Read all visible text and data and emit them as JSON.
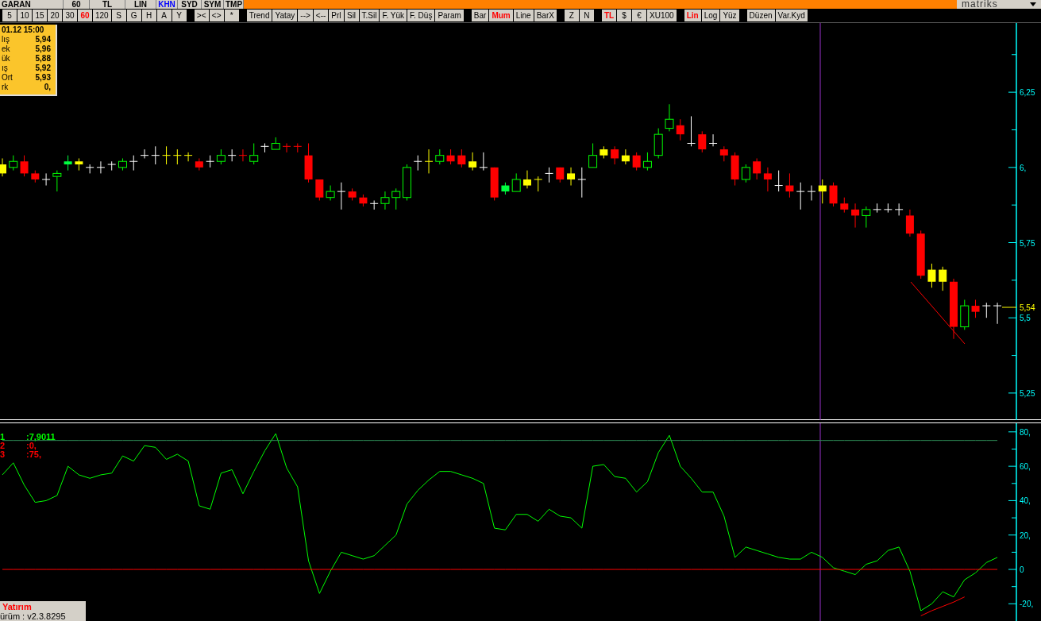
{
  "top_bar": {
    "items": [
      {
        "label": "GARAN",
        "highlighted": false
      },
      {
        "label": "60",
        "highlighted": false
      },
      {
        "label": "TL",
        "highlighted": false
      },
      {
        "label": "LIN",
        "highlighted": false
      },
      {
        "label": "KHN",
        "highlighted": true
      },
      {
        "label": "SYD",
        "highlighted": false
      },
      {
        "label": "SYM",
        "highlighted": false
      },
      {
        "label": "TMP",
        "highlighted": false
      }
    ],
    "logo": "matriks"
  },
  "toolbar": {
    "groups": [
      [
        {
          "label": "5",
          "selected": false
        },
        {
          "label": "10",
          "selected": false
        },
        {
          "label": "15",
          "selected": false
        },
        {
          "label": "20",
          "selected": false
        },
        {
          "label": "30",
          "selected": false
        },
        {
          "label": "60",
          "selected": true
        },
        {
          "label": "120",
          "selected": false
        },
        {
          "label": "S",
          "selected": false
        },
        {
          "label": "G",
          "selected": false
        },
        {
          "label": "H",
          "selected": false
        },
        {
          "label": "A",
          "selected": false
        },
        {
          "label": "Y",
          "selected": false
        }
      ],
      [
        {
          "label": "><",
          "selected": false
        },
        {
          "label": "<>",
          "selected": false
        },
        {
          "label": "*",
          "selected": false
        }
      ],
      [
        {
          "label": "Trend",
          "selected": false
        },
        {
          "label": "Yatay",
          "selected": false
        },
        {
          "label": "-->",
          "selected": false
        },
        {
          "label": "<--",
          "selected": false
        },
        {
          "label": "Prl",
          "selected": false
        },
        {
          "label": "Sil",
          "selected": false
        },
        {
          "label": "T.Sil",
          "selected": false
        },
        {
          "label": "F. Yük",
          "selected": false
        },
        {
          "label": "F. Düş",
          "selected": false
        },
        {
          "label": "Param",
          "selected": false
        }
      ],
      [
        {
          "label": "Bar",
          "selected": false
        },
        {
          "label": "Mum",
          "selected": true
        },
        {
          "label": "Line",
          "selected": false
        },
        {
          "label": "BarX",
          "selected": false
        }
      ],
      [
        {
          "label": "Z",
          "selected": false
        },
        {
          "label": "N",
          "selected": false
        }
      ],
      [
        {
          "label": "TL",
          "selected": true
        },
        {
          "label": "$",
          "selected": false
        },
        {
          "label": "€",
          "selected": false
        },
        {
          "label": "XU100",
          "selected": false
        }
      ],
      [
        {
          "label": "Lin",
          "selected": true
        },
        {
          "label": "Log",
          "selected": false
        },
        {
          "label": "Yüz",
          "selected": false
        }
      ],
      [
        {
          "label": "Düzen",
          "selected": false
        },
        {
          "label": "Var.Kyd",
          "selected": false
        }
      ]
    ]
  },
  "info_box": {
    "title": "01.12 15:00",
    "rows": [
      {
        "label": "lış",
        "value": "5,94"
      },
      {
        "label": "ek",
        "value": "5,96"
      },
      {
        "label": "ük",
        "value": "5,88"
      },
      {
        "label": "ış",
        "value": "5,92"
      },
      {
        "label": "Ort",
        "value": "5,93"
      },
      {
        "label": "rk",
        "value": "0,"
      }
    ]
  },
  "price_panel": {
    "current_price": "5,54",
    "chart_data": {
      "type": "candlestick",
      "ylim": [
        5.16,
        6.48
      ],
      "yticks": [
        {
          "value": 6.25,
          "label": "6,25"
        },
        {
          "value": 6,
          "label": "6,"
        },
        {
          "value": 5.75,
          "label": "5,75"
        },
        {
          "value": 5.5,
          "label": "5,5"
        },
        {
          "value": 5.25,
          "label": "5,25"
        }
      ],
      "ohlc": [
        [
          6.01,
          6.03,
          5.97,
          5.98
        ],
        [
          6.0,
          6.04,
          5.99,
          6.02
        ],
        [
          6.02,
          6.04,
          5.97,
          5.98
        ],
        [
          5.98,
          5.99,
          5.95,
          5.96
        ],
        [
          5.96,
          5.98,
          5.94,
          5.96
        ],
        [
          5.97,
          5.99,
          5.92,
          5.98
        ],
        [
          6.01,
          6.04,
          5.99,
          6.02
        ],
        [
          6.02,
          6.03,
          5.99,
          6.01
        ],
        [
          6.0,
          6.01,
          5.98,
          6.0
        ],
        [
          6.0,
          6.02,
          5.98,
          6.0
        ],
        [
          6.01,
          6.02,
          5.99,
          6.01
        ],
        [
          6.0,
          6.03,
          5.99,
          6.02
        ],
        [
          6.02,
          6.04,
          5.99,
          6.02
        ],
        [
          6.04,
          6.06,
          6.03,
          6.04
        ],
        [
          6.04,
          6.07,
          6.01,
          6.04
        ],
        [
          6.04,
          6.07,
          6.01,
          6.04
        ],
        [
          6.04,
          6.06,
          6.01,
          6.04
        ],
        [
          6.04,
          6.05,
          6.02,
          6.04
        ],
        [
          6.02,
          6.03,
          5.99,
          6.0
        ],
        [
          6.02,
          6.04,
          6.0,
          6.02
        ],
        [
          6.02,
          6.06,
          6.01,
          6.04
        ],
        [
          6.04,
          6.06,
          6.02,
          6.04
        ],
        [
          6.04,
          6.06,
          6.02,
          6.04
        ],
        [
          6.02,
          6.08,
          6.01,
          6.04
        ],
        [
          6.07,
          6.08,
          6.05,
          6.07
        ],
        [
          6.06,
          6.1,
          6.06,
          6.08
        ],
        [
          6.07,
          6.08,
          6.05,
          6.07
        ],
        [
          6.07,
          6.08,
          6.05,
          6.07
        ],
        [
          6.04,
          6.08,
          5.95,
          5.96
        ],
        [
          5.96,
          5.96,
          5.89,
          5.9
        ],
        [
          5.9,
          5.94,
          5.89,
          5.92
        ],
        [
          5.92,
          5.95,
          5.86,
          5.92
        ],
        [
          5.92,
          5.93,
          5.89,
          5.9
        ],
        [
          5.9,
          5.91,
          5.87,
          5.88
        ],
        [
          5.88,
          5.89,
          5.86,
          5.88
        ],
        [
          5.88,
          5.92,
          5.86,
          5.9
        ],
        [
          5.9,
          5.93,
          5.86,
          5.92
        ],
        [
          5.9,
          6.01,
          5.89,
          6.0
        ],
        [
          6.02,
          6.04,
          5.99,
          6.02
        ],
        [
          6.02,
          6.06,
          5.98,
          6.02
        ],
        [
          6.02,
          6.06,
          6.01,
          6.04
        ],
        [
          6.04,
          6.06,
          6.01,
          6.02
        ],
        [
          6.04,
          6.06,
          6.0,
          6.01
        ],
        [
          6.02,
          6.05,
          5.99,
          6.0
        ],
        [
          6.0,
          6.05,
          5.99,
          6.0
        ],
        [
          6.0,
          6.0,
          5.89,
          5.9
        ],
        [
          5.92,
          5.95,
          5.91,
          5.94
        ],
        [
          5.92,
          5.98,
          5.92,
          5.96
        ],
        [
          5.96,
          5.99,
          5.93,
          5.94
        ],
        [
          5.96,
          5.97,
          5.92,
          5.96
        ],
        [
          5.98,
          6.0,
          5.95,
          5.98
        ],
        [
          6.0,
          6.0,
          5.95,
          5.96
        ],
        [
          5.98,
          6.0,
          5.94,
          5.96
        ],
        [
          5.96,
          6.0,
          5.9,
          5.96
        ],
        [
          6.0,
          6.08,
          6.0,
          6.04
        ],
        [
          6.06,
          6.07,
          6.03,
          6.04
        ],
        [
          6.06,
          6.07,
          6.01,
          6.03
        ],
        [
          6.04,
          6.06,
          6.01,
          6.02
        ],
        [
          6.04,
          6.05,
          5.99,
          6.0
        ],
        [
          6.0,
          6.05,
          5.99,
          6.02
        ],
        [
          6.04,
          6.13,
          6.03,
          6.11
        ],
        [
          6.13,
          6.21,
          6.12,
          6.16
        ],
        [
          6.14,
          6.16,
          6.09,
          6.11
        ],
        [
          6.08,
          6.17,
          6.07,
          6.08
        ],
        [
          6.11,
          6.12,
          6.05,
          6.06
        ],
        [
          6.08,
          6.11,
          6.07,
          6.08
        ],
        [
          6.06,
          6.07,
          6.02,
          6.04
        ],
        [
          6.04,
          6.05,
          5.94,
          5.96
        ],
        [
          5.96,
          6.01,
          5.95,
          6.0
        ],
        [
          6.02,
          6.03,
          5.96,
          5.98
        ],
        [
          5.98,
          6.0,
          5.92,
          5.96
        ],
        [
          5.94,
          5.99,
          5.92,
          5.94
        ],
        [
          5.94,
          5.98,
          5.9,
          5.92
        ],
        [
          5.92,
          5.95,
          5.86,
          5.92
        ],
        [
          5.92,
          5.94,
          5.89,
          5.92
        ],
        [
          5.94,
          5.96,
          5.88,
          5.92
        ],
        [
          5.94,
          5.95,
          5.87,
          5.88
        ],
        [
          5.88,
          5.9,
          5.85,
          5.86
        ],
        [
          5.86,
          5.88,
          5.8,
          5.84
        ],
        [
          5.84,
          5.87,
          5.8,
          5.86
        ],
        [
          5.86,
          5.88,
          5.85,
          5.86
        ],
        [
          5.86,
          5.88,
          5.85,
          5.86
        ],
        [
          5.86,
          5.88,
          5.84,
          5.86
        ],
        [
          5.84,
          5.86,
          5.77,
          5.78
        ],
        [
          5.78,
          5.79,
          5.63,
          5.64
        ],
        [
          5.66,
          5.68,
          5.6,
          5.62
        ],
        [
          5.66,
          5.67,
          5.59,
          5.62
        ],
        [
          5.62,
          5.63,
          5.43,
          5.47
        ],
        [
          5.47,
          5.56,
          5.46,
          5.54
        ],
        [
          5.54,
          5.56,
          5.5,
          5.52
        ],
        [
          5.54,
          5.55,
          5.5,
          5.54
        ],
        [
          5.54,
          5.55,
          5.48,
          5.54
        ]
      ],
      "colors": [
        "#ffff00",
        "#00ff00",
        "#ff0000",
        "#ff0000",
        "#ffffff",
        "#00ff00",
        "#00ff40",
        "#ffff00",
        "#ffffff",
        "#ffffff",
        "#ffffff",
        "#00ff00",
        "#ffffff",
        "#ffffff",
        "#ffffff",
        "#ffff00",
        "#ffff00",
        "#ffff00",
        "#ff0000",
        "#ffffff",
        "#00ff00",
        "#ffffff",
        "#ff0000",
        "#00ff00",
        "#ffffff",
        "#00ff00",
        "#ff0000",
        "#ff0000",
        "#ff0000",
        "#ff0000",
        "#00ff00",
        "#ffffff",
        "#ff0000",
        "#ff0000",
        "#ffffff",
        "#00ff00",
        "#00ff00",
        "#00ff00",
        "#ffffff",
        "#ffff00",
        "#00ff00",
        "#ff0000",
        "#ff0000",
        "#ffff00",
        "#ffffff",
        "#ff0000",
        "#00ff40",
        "#00ff00",
        "#ffff00",
        "#ffff00",
        "#ffffff",
        "#ff0000",
        "#ffff00",
        "#ffffff",
        "#00ff00",
        "#ffff00",
        "#ff0000",
        "#ffff00",
        "#ff0000",
        "#00ff00",
        "#00ff00",
        "#00ff00",
        "#ff0000",
        "#ffffff",
        "#ff0000",
        "#ffffff",
        "#ff0000",
        "#ff0000",
        "#00ff00",
        "#ff0000",
        "#ff0000",
        "#ffffff",
        "#ff0000",
        "#ffffff",
        "#ffffff",
        "#ffff00",
        "#ff0000",
        "#ff0000",
        "#ff0000",
        "#00ff00",
        "#ffffff",
        "#ffffff",
        "#ffffff",
        "#ff0000",
        "#ff0000",
        "#ffff00",
        "#ffff00",
        "#ff0000",
        "#00ff00",
        "#ff0000",
        "#ffffff",
        "#ffffff"
      ]
    }
  },
  "oscillator": {
    "legend": [
      {
        "value": ":7,9011",
        "color": "#00ff00"
      },
      {
        "value": ":0,",
        "color": "#ff0000"
      },
      {
        "value": ":75,",
        "color": "#ff0000"
      }
    ],
    "chart_data": {
      "type": "line",
      "ylim": [
        -30,
        85
      ],
      "yticks": [
        {
          "value": 80,
          "label": "80,"
        },
        {
          "value": 60,
          "label": "60,"
        },
        {
          "value": 40,
          "label": "40,"
        },
        {
          "value": 20,
          "label": "20,"
        },
        {
          "value": 0,
          "label": "0"
        },
        {
          "value": -20,
          "label": "-20,"
        }
      ],
      "series": [
        {
          "name": "1",
          "color": "#00ff00",
          "values": [
            55,
            62,
            49,
            39,
            40,
            43,
            60,
            55,
            53,
            55,
            56,
            66,
            63,
            72,
            71,
            64,
            67,
            63,
            37,
            35,
            56,
            58,
            44,
            57,
            69,
            79,
            59,
            48,
            5,
            -14,
            -1,
            10,
            8,
            6,
            8,
            14,
            20,
            38,
            46,
            52,
            57,
            57,
            55,
            53,
            50,
            24,
            23,
            32,
            32,
            28,
            35,
            31,
            30,
            24,
            60,
            61,
            54,
            53,
            45,
            51,
            68,
            78,
            60,
            53,
            45,
            45,
            31,
            7,
            13,
            11,
            9,
            7,
            6,
            6,
            10,
            7,
            1,
            -1,
            -3,
            3,
            5,
            11,
            13,
            -1,
            -24,
            -20,
            -13,
            -16,
            -6,
            -2,
            4,
            7
          ]
        },
        {
          "name": "2",
          "color": "#ff0000",
          "values": [
            0,
            0,
            0,
            0,
            0,
            0,
            0,
            0,
            0,
            0,
            0,
            0,
            0,
            0,
            0,
            0,
            0,
            0,
            0,
            0,
            0,
            0,
            0,
            0,
            0,
            0,
            0,
            0,
            0,
            0,
            0,
            0,
            0,
            0,
            0,
            0,
            0,
            0,
            0,
            0,
            0,
            0,
            0,
            0,
            0,
            0,
            0,
            0,
            0,
            0,
            0,
            0,
            0,
            0,
            0,
            0,
            0,
            0,
            0,
            0,
            0,
            0,
            0,
            0,
            0,
            0,
            0,
            0,
            0,
            0,
            0,
            0,
            0,
            0,
            0,
            0,
            0,
            0,
            0,
            0,
            0,
            0,
            0,
            0,
            0,
            0,
            0,
            0,
            0,
            0,
            0,
            0
          ]
        },
        {
          "name": "3",
          "color": "#2e8b57",
          "values": [
            75,
            75,
            75,
            75,
            75,
            75,
            75,
            75,
            75,
            75,
            75,
            75,
            75,
            75,
            75,
            75,
            75,
            75,
            75,
            75,
            75,
            75,
            75,
            75,
            75,
            75,
            75,
            75,
            75,
            75,
            75,
            75,
            75,
            75,
            75,
            75,
            75,
            75,
            75,
            75,
            75,
            75,
            75,
            75,
            75,
            75,
            75,
            75,
            75,
            75,
            75,
            75,
            75,
            75,
            75,
            75,
            75,
            75,
            75,
            75,
            75,
            75,
            75,
            75,
            75,
            75,
            75,
            75,
            75,
            75,
            75,
            75,
            75,
            75,
            75,
            75,
            75,
            75,
            75,
            75,
            75,
            75,
            75,
            75,
            75,
            75,
            75,
            75,
            75,
            75,
            75,
            75
          ]
        },
        {
          "color": "#ff0000",
          "values": [
            null,
            null,
            null,
            null,
            null,
            null,
            null,
            null,
            null,
            null,
            null,
            null,
            null,
            null,
            null,
            null,
            null,
            null,
            null,
            null,
            null,
            null,
            null,
            null,
            null,
            null,
            null,
            null,
            null,
            null,
            null,
            null,
            null,
            null,
            null,
            null,
            null,
            null,
            null,
            null,
            null,
            null,
            null,
            null,
            null,
            null,
            null,
            null,
            null,
            null,
            null,
            null,
            null,
            null,
            null,
            null,
            null,
            null,
            null,
            null,
            null,
            null,
            null,
            null,
            null,
            null,
            null,
            null,
            null,
            null,
            null,
            null,
            null,
            null,
            null,
            null,
            null,
            null,
            null,
            null,
            null,
            null,
            null,
            null,
            -27,
            -24,
            -21.5,
            -19,
            -16,
            null,
            null,
            null
          ]
        }
      ]
    }
  },
  "footer": {
    "brand": "Yatırım",
    "version": "ürüm : v2.3.8295"
  }
}
